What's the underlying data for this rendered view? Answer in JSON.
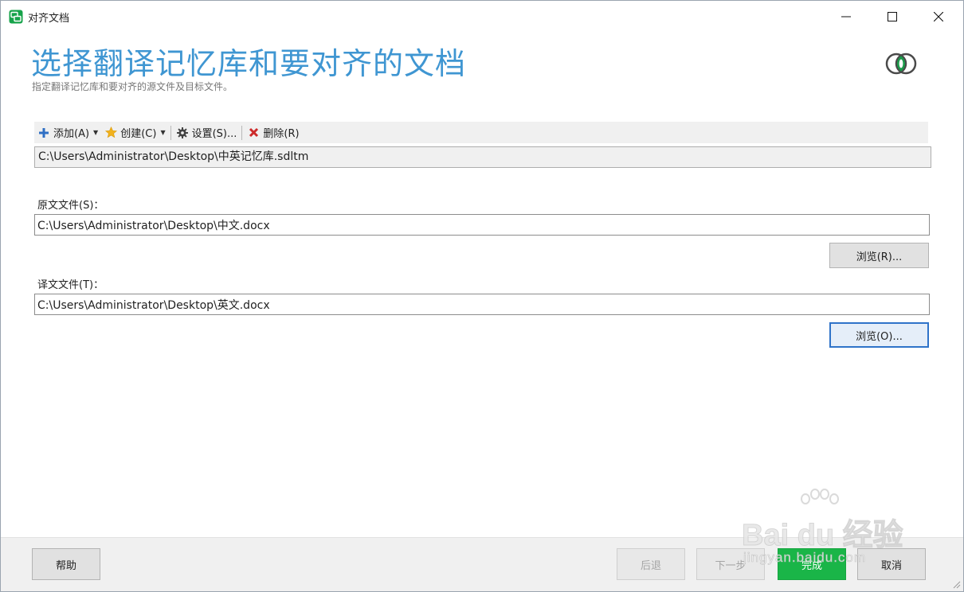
{
  "window": {
    "title": "对齐文档",
    "controls": {
      "minimize": "minimize-icon",
      "maximize": "maximize-icon",
      "close": "close-icon"
    }
  },
  "header": {
    "title": "选择翻译记忆库和要对齐的文档",
    "subtitle": "指定翻译记忆库和要对齐的源文件及目标文件。",
    "accent_color": "#3f96d2"
  },
  "toolbar": {
    "add_label": "添加(A)",
    "create_label": "创建(C)",
    "settings_label": "设置(S)...",
    "remove_label": "删除(R)"
  },
  "translation_memory": {
    "path": "C:\\Users\\Administrator\\Desktop\\中英记忆库.sdltm"
  },
  "source": {
    "label": "原文文件(S)：",
    "value": "C:\\Users\\Administrator\\Desktop\\中文.docx",
    "browse_label": "浏览(R)..."
  },
  "target": {
    "label": "译文文件(T)：",
    "value": "C:\\Users\\Administrator\\Desktop\\英文.docx",
    "browse_label": "浏览(O)..."
  },
  "footer": {
    "help_label": "帮助",
    "back_label": "后退",
    "next_label": "下一步",
    "finish_label": "完成",
    "cancel_label": "取消",
    "finish_color": "#1ab548"
  },
  "watermark": {
    "brand": "Bai du 经验",
    "sub": "jingyan.baidu.com"
  }
}
